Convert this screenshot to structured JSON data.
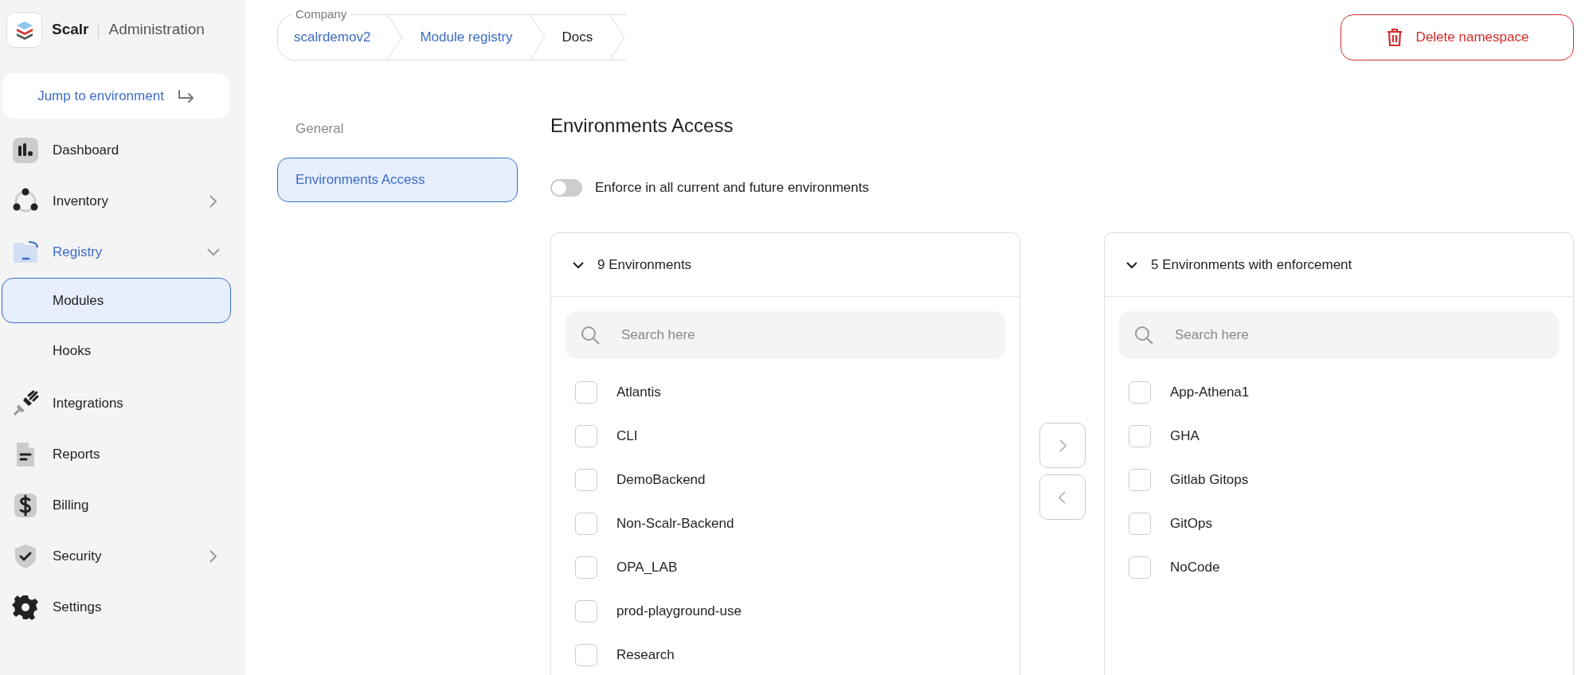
{
  "sidebar": {
    "brand": "Scalr",
    "section": "Administration",
    "jump_button": "Jump to environment",
    "items": [
      {
        "label": "Dashboard",
        "selected": false
      },
      {
        "label": "Inventory",
        "selected": false,
        "expanded": false
      },
      {
        "label": "Registry",
        "selected": true,
        "expanded": true,
        "children": [
          {
            "label": "Modules",
            "selected": true
          },
          {
            "label": "Hooks",
            "selected": false
          }
        ]
      },
      {
        "label": "Integrations",
        "selected": false
      },
      {
        "label": "Reports",
        "selected": false
      },
      {
        "label": "Billing",
        "selected": false
      },
      {
        "label": "Security",
        "selected": false,
        "expanded": false
      },
      {
        "label": "Settings",
        "selected": false
      }
    ]
  },
  "breadcrumb": {
    "label": "Company",
    "items": [
      {
        "text": "scalrdemov2",
        "link": true
      },
      {
        "text": "Module registry",
        "link": true
      },
      {
        "text": "Docs",
        "link": false
      }
    ]
  },
  "delete_button": "Delete namespace",
  "settings_nav": [
    {
      "label": "General",
      "selected": false
    },
    {
      "label": "Environments Access",
      "selected": true
    }
  ],
  "title": "Environments Access",
  "toggle": {
    "label": "Enforce in all current and future environments",
    "on": false
  },
  "panels": [
    {
      "title": "9 Environments",
      "expanded": true,
      "search_placeholder": "Search here",
      "items": [
        {
          "label": "Atlantis",
          "checked": false
        },
        {
          "label": "CLI",
          "checked": false
        },
        {
          "label": "DemoBackend",
          "checked": false
        },
        {
          "label": "Non-Scalr-Backend",
          "checked": false
        },
        {
          "label": "OPA_LAB",
          "checked": false
        },
        {
          "label": "prod-playground-use",
          "checked": false
        },
        {
          "label": "Research",
          "checked": false
        }
      ]
    },
    {
      "title": "5 Environments with enforcement",
      "expanded": true,
      "search_placeholder": "Search here",
      "items": [
        {
          "label": "App-Athena1",
          "checked": false
        },
        {
          "label": "GHA",
          "checked": false
        },
        {
          "label": "Gitlab Gitops",
          "checked": false
        },
        {
          "label": "GitOps",
          "checked": false
        },
        {
          "label": "NoCode",
          "checked": false
        }
      ]
    }
  ],
  "transfer_buttons": [
    {
      "kind": "forward",
      "disabled": true
    },
    {
      "kind": "back",
      "disabled": true
    }
  ]
}
